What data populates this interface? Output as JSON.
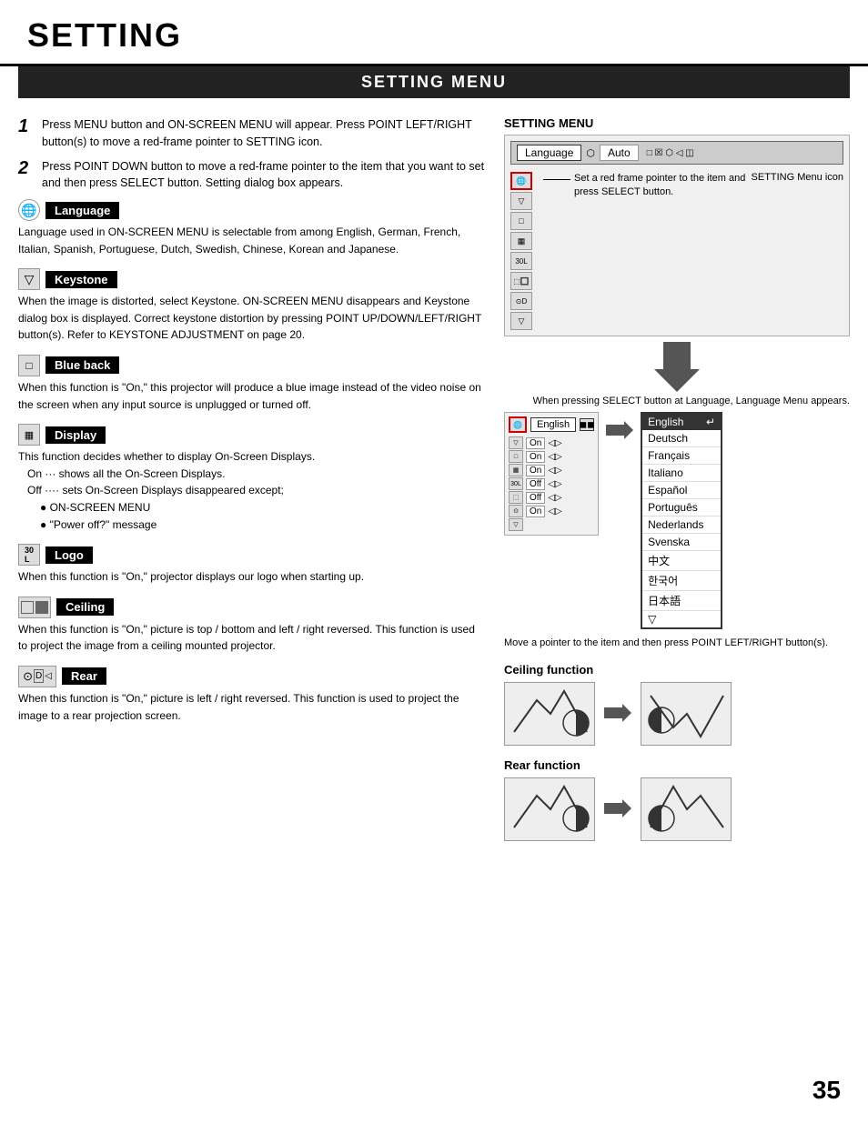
{
  "page": {
    "title": "SETTING",
    "page_number": "35"
  },
  "section_heading": "SETTING MENU",
  "steps": [
    {
      "num": "1",
      "text": "Press MENU button and ON-SCREEN MENU will appear.  Press POINT LEFT/RIGHT button(s) to move a red-frame pointer to SETTING icon."
    },
    {
      "num": "2",
      "text": "Press POINT DOWN button to move a red-frame pointer to the item that you want to set and then press SELECT button. Setting dialog box appears."
    }
  ],
  "items": [
    {
      "id": "language",
      "label": "Language",
      "icon": "🌐",
      "desc": "Language used in ON-SCREEN MENU is selectable from among English, German, French, Italian, Spanish, Portuguese, Dutch, Swedish, Chinese, Korean and Japanese."
    },
    {
      "id": "keystone",
      "label": "Keystone",
      "icon": "▽",
      "desc": "When the image is distorted, select Keystone.  ON-SCREEN MENU disappears and Keystone dialog box is displayed.  Correct keystone distortion by pressing POINT UP/DOWN/LEFT/RIGHT button(s).  Refer to KEYSTONE ADJUSTMENT on page 20."
    },
    {
      "id": "blue-back",
      "label": "Blue back",
      "icon": "□",
      "desc": "When this function is \"On,\" this projector will produce a blue image instead of the video noise on the screen when any input source is unplugged or turned off."
    },
    {
      "id": "display",
      "label": "Display",
      "icon": "▦",
      "desc_lines": [
        "This function decides whether to display On-Screen Displays.",
        "On  ···  shows all the On-Screen Displays.",
        "Off ····  sets On-Screen Displays disappeared except;",
        "● ON-SCREEN MENU",
        "● \"Power off?\" message"
      ]
    },
    {
      "id": "logo",
      "label": "Logo",
      "icon": "30L",
      "desc": "When this function is \"On,\" projector displays our logo when starting up."
    },
    {
      "id": "ceiling",
      "label": "Ceiling",
      "icon": "⬚🔲",
      "desc": "When this function is \"On,\" picture is top / bottom and left / right reversed.  This function is used to project the image from a ceiling mounted projector."
    },
    {
      "id": "rear",
      "label": "Rear",
      "icon": "⊙D◁",
      "desc": "When this function is \"On,\" picture is left / right reversed.  This function is used to project the image to a rear projection screen."
    }
  ],
  "right_panel": {
    "setting_menu_label": "SETTING MENU",
    "menu_bar": {
      "language_label": "Language",
      "auto_label": "Auto"
    },
    "annotation_red_frame": "Set a red frame pointer to the item and press SELECT button.",
    "annotation_setting_icon": "SETTING Menu icon",
    "arrow_note": "When pressing SELECT button at Language, Language Menu appears.",
    "english_label": "English",
    "languages": [
      {
        "name": "English",
        "selected": true
      },
      {
        "name": "Deutsch",
        "selected": false
      },
      {
        "name": "Français",
        "selected": false
      },
      {
        "name": "Italiano",
        "selected": false
      },
      {
        "name": "Español",
        "selected": false
      },
      {
        "name": "Português",
        "selected": false
      },
      {
        "name": "Nederlands",
        "selected": false
      },
      {
        "name": "Svenska",
        "selected": false
      },
      {
        "name": "中文",
        "selected": false
      },
      {
        "name": "한국어",
        "selected": false
      },
      {
        "name": "日本語",
        "selected": false
      }
    ],
    "move_note": "Move a pointer to the item and then press POINT LEFT/RIGHT button(s).",
    "ceiling_function_label": "Ceiling function",
    "rear_function_label": "Rear function"
  }
}
